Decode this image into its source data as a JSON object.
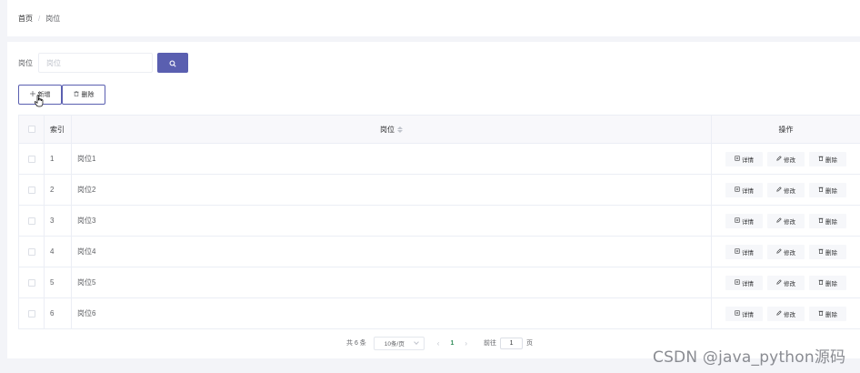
{
  "breadcrumb": {
    "home": "首页",
    "separator": "/",
    "current": "岗位"
  },
  "search": {
    "label": "岗位",
    "placeholder": "岗位",
    "value": "",
    "button_icon": "search-icon"
  },
  "actions": {
    "add_label": "新增",
    "delete_label": "删除"
  },
  "table": {
    "headers": {
      "index": "索引",
      "position": "岗位",
      "operations": "操作"
    },
    "rows": [
      {
        "index": "1",
        "position": "岗位1"
      },
      {
        "index": "2",
        "position": "岗位2"
      },
      {
        "index": "3",
        "position": "岗位3"
      },
      {
        "index": "4",
        "position": "岗位4"
      },
      {
        "index": "5",
        "position": "岗位5"
      },
      {
        "index": "6",
        "position": "岗位6"
      }
    ],
    "row_actions": {
      "detail": "详情",
      "edit": "修改",
      "delete": "删除"
    }
  },
  "pagination": {
    "total_text": "共 6 条",
    "page_size": "10条/页",
    "current_page": "1",
    "goto_label": "前往",
    "goto_value": "1",
    "goto_suffix": "页"
  },
  "watermark": "CSDN @java_python源码",
  "colors": {
    "accent": "#5a5fb0",
    "page_active": "#2e8b57"
  }
}
